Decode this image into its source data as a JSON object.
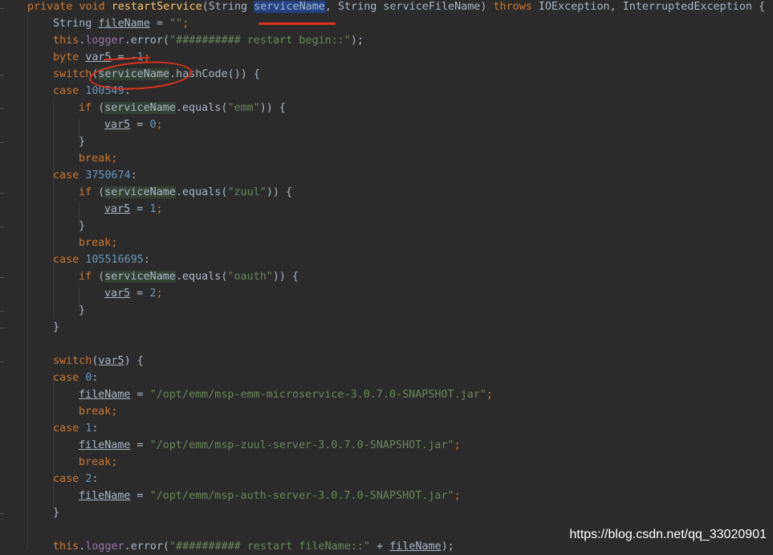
{
  "code": {
    "l1": {
      "kw1": "private",
      "kw2": "void",
      "name": "restartService",
      "p1": "(String ",
      "param": "serviceName",
      "p2": ", String serviceFileName) ",
      "kw3": "throws",
      "p3": " IOException, InterruptedException {"
    },
    "l2": {
      "a": "String ",
      "v": "fileName",
      "b": " = ",
      "s": "\"\"",
      "c": ";"
    },
    "l3": {
      "kw": "this",
      "a": ".",
      "f": "logger",
      "b": ".error(",
      "s": "\"########## restart begin::\"",
      "c": ");"
    },
    "l4": {
      "kw": "byte ",
      "v": "var5",
      "b": " = ",
      "n": "-1",
      "c": ";"
    },
    "l5": {
      "kw": "switch",
      "a": "(",
      "p": "serviceName",
      "b": ".hashCode()) {"
    },
    "l6": {
      "kw": "case ",
      "n": "100549",
      "c": ":"
    },
    "l7": {
      "kw": "if ",
      "a": "(",
      "p": "serviceName",
      "b": ".equals(",
      "s": "\"emm\"",
      "c": ")) {"
    },
    "l8": {
      "v": "var5",
      "b": " = ",
      "n": "0",
      "c": ";"
    },
    "l9": {
      "t": "}"
    },
    "l10": {
      "kw": "break",
      "c": ";"
    },
    "l11": {
      "kw": "case ",
      "n": "3750674",
      "c": ":"
    },
    "l12": {
      "kw": "if ",
      "a": "(",
      "p": "serviceName",
      "b": ".equals(",
      "s": "\"zuul\"",
      "c": ")) {"
    },
    "l13": {
      "v": "var5",
      "b": " = ",
      "n": "1",
      "c": ";"
    },
    "l14": {
      "t": "}"
    },
    "l15": {
      "kw": "break",
      "c": ";"
    },
    "l16": {
      "kw": "case ",
      "n": "105516695",
      "c": ":"
    },
    "l17": {
      "kw": "if ",
      "a": "(",
      "p": "serviceName",
      "b": ".equals(",
      "s": "\"oauth\"",
      "c": ")) {"
    },
    "l18": {
      "v": "var5",
      "b": " = ",
      "n": "2",
      "c": ";"
    },
    "l19": {
      "t": "}"
    },
    "l20": {
      "t": "}"
    },
    "l22": {
      "kw": "switch",
      "a": "(",
      "v": "var5",
      "b": ") {"
    },
    "l23": {
      "kw": "case ",
      "n": "0",
      "c": ":"
    },
    "l24": {
      "v": "fileName",
      "b": " = ",
      "s": "\"/opt/emm/msp-emm-microservice-3.0.7.0-SNAPSHOT.jar\"",
      "c": ";"
    },
    "l25": {
      "kw": "break",
      "c": ";"
    },
    "l26": {
      "kw": "case ",
      "n": "1",
      "c": ":"
    },
    "l27": {
      "v": "fileName",
      "b": " = ",
      "s": "\"/opt/emm/msp-zuul-server-3.0.7.0-SNAPSHOT.jar\"",
      "c": ";"
    },
    "l28": {
      "kw": "break",
      "c": ";"
    },
    "l29": {
      "kw": "case ",
      "n": "2",
      "c": ":"
    },
    "l30": {
      "v": "fileName",
      "b": " = ",
      "s": "\"/opt/emm/msp-auth-server-3.0.7.0-SNAPSHOT.jar\"",
      "c": ";"
    },
    "l31": {
      "t": "}"
    },
    "l33": {
      "kw": "this",
      "a": ".",
      "f": "logger",
      "b": ".error(",
      "s": "\"########## restart fileName::\"",
      "c": " + ",
      "v": "fileName",
      "d": ");"
    }
  },
  "watermark": "https://blog.csdn.net/qq_33020901",
  "colors": {
    "background": "#2b2b2b",
    "keyword": "#cc7832",
    "string": "#6a8759",
    "number": "#6897bb",
    "method": "#ffc66d",
    "field": "#9876aa",
    "annotation": "#e0321c"
  }
}
